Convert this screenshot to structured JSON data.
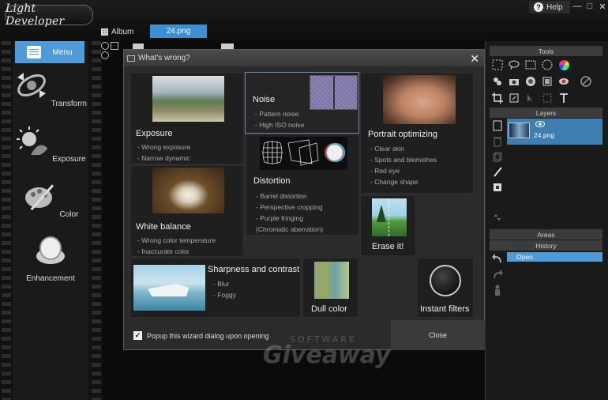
{
  "app": {
    "logo_text": "Light Developer",
    "help_label": "Help",
    "help_icon": "?",
    "minimize": "—",
    "maximize": "□",
    "close": "✕"
  },
  "header": {
    "album_label": "Album",
    "file_tab": "24.png"
  },
  "left_menu": {
    "menu_label": "Menu",
    "items": [
      {
        "label": "Transform",
        "icon": "transform-icon",
        "color": "#c9c9c9"
      },
      {
        "label": "Exposure",
        "icon": "exposure-icon",
        "color": "#b0b0b0"
      },
      {
        "label": "Color",
        "icon": "color-icon",
        "color": "#c0c0c0"
      },
      {
        "label": "Enhancement",
        "icon": "enhancement-icon",
        "color": "#d0d0d0"
      }
    ]
  },
  "dialog": {
    "title": "What's wrong?",
    "close_icon": "✕",
    "tiles": {
      "exposure": {
        "title": "Exposure",
        "lines": [
          "- Wrong exposure",
          "- Narrow dynamic"
        ]
      },
      "noise": {
        "title": "Noise",
        "lines": [
          "- Pattern noise",
          "- High ISO noise"
        ]
      },
      "portrait": {
        "title": "Portrait optimizing",
        "lines": [
          "- Clear skin",
          "- Spots and blemishes",
          "- Red eye",
          "- Change shape"
        ]
      },
      "distortion": {
        "title": "Distortion",
        "lines": [
          "- Barrel distortion",
          "- Perspective cropping",
          "- Purple fringing",
          "(Chromatic aberration)"
        ]
      },
      "white_balance": {
        "title": "White balance",
        "lines": [
          "- Wrong color temperature",
          "- Inaccurate color"
        ]
      },
      "erase": {
        "title": "Erase it!"
      },
      "sharpness": {
        "title": "Sharpness and contrast",
        "lines": [
          "- Blur",
          "- Foggy"
        ]
      },
      "dull": {
        "title": "Dull color"
      },
      "instant": {
        "title": "Instant filters"
      }
    },
    "popup_checkbox_label": "Popup this wizard dialog upon opening",
    "popup_checked": "✓",
    "close_button": "Close"
  },
  "watermark": {
    "top": "SOFTWARE",
    "main": "Giveaway"
  },
  "right_panel": {
    "tools_header": "Tools",
    "layers_header": "Layers",
    "layer_name": "24.png",
    "areas_header": "Areas",
    "history_header": "History",
    "history_item": "Open",
    "accent": "#4e9bd8"
  }
}
